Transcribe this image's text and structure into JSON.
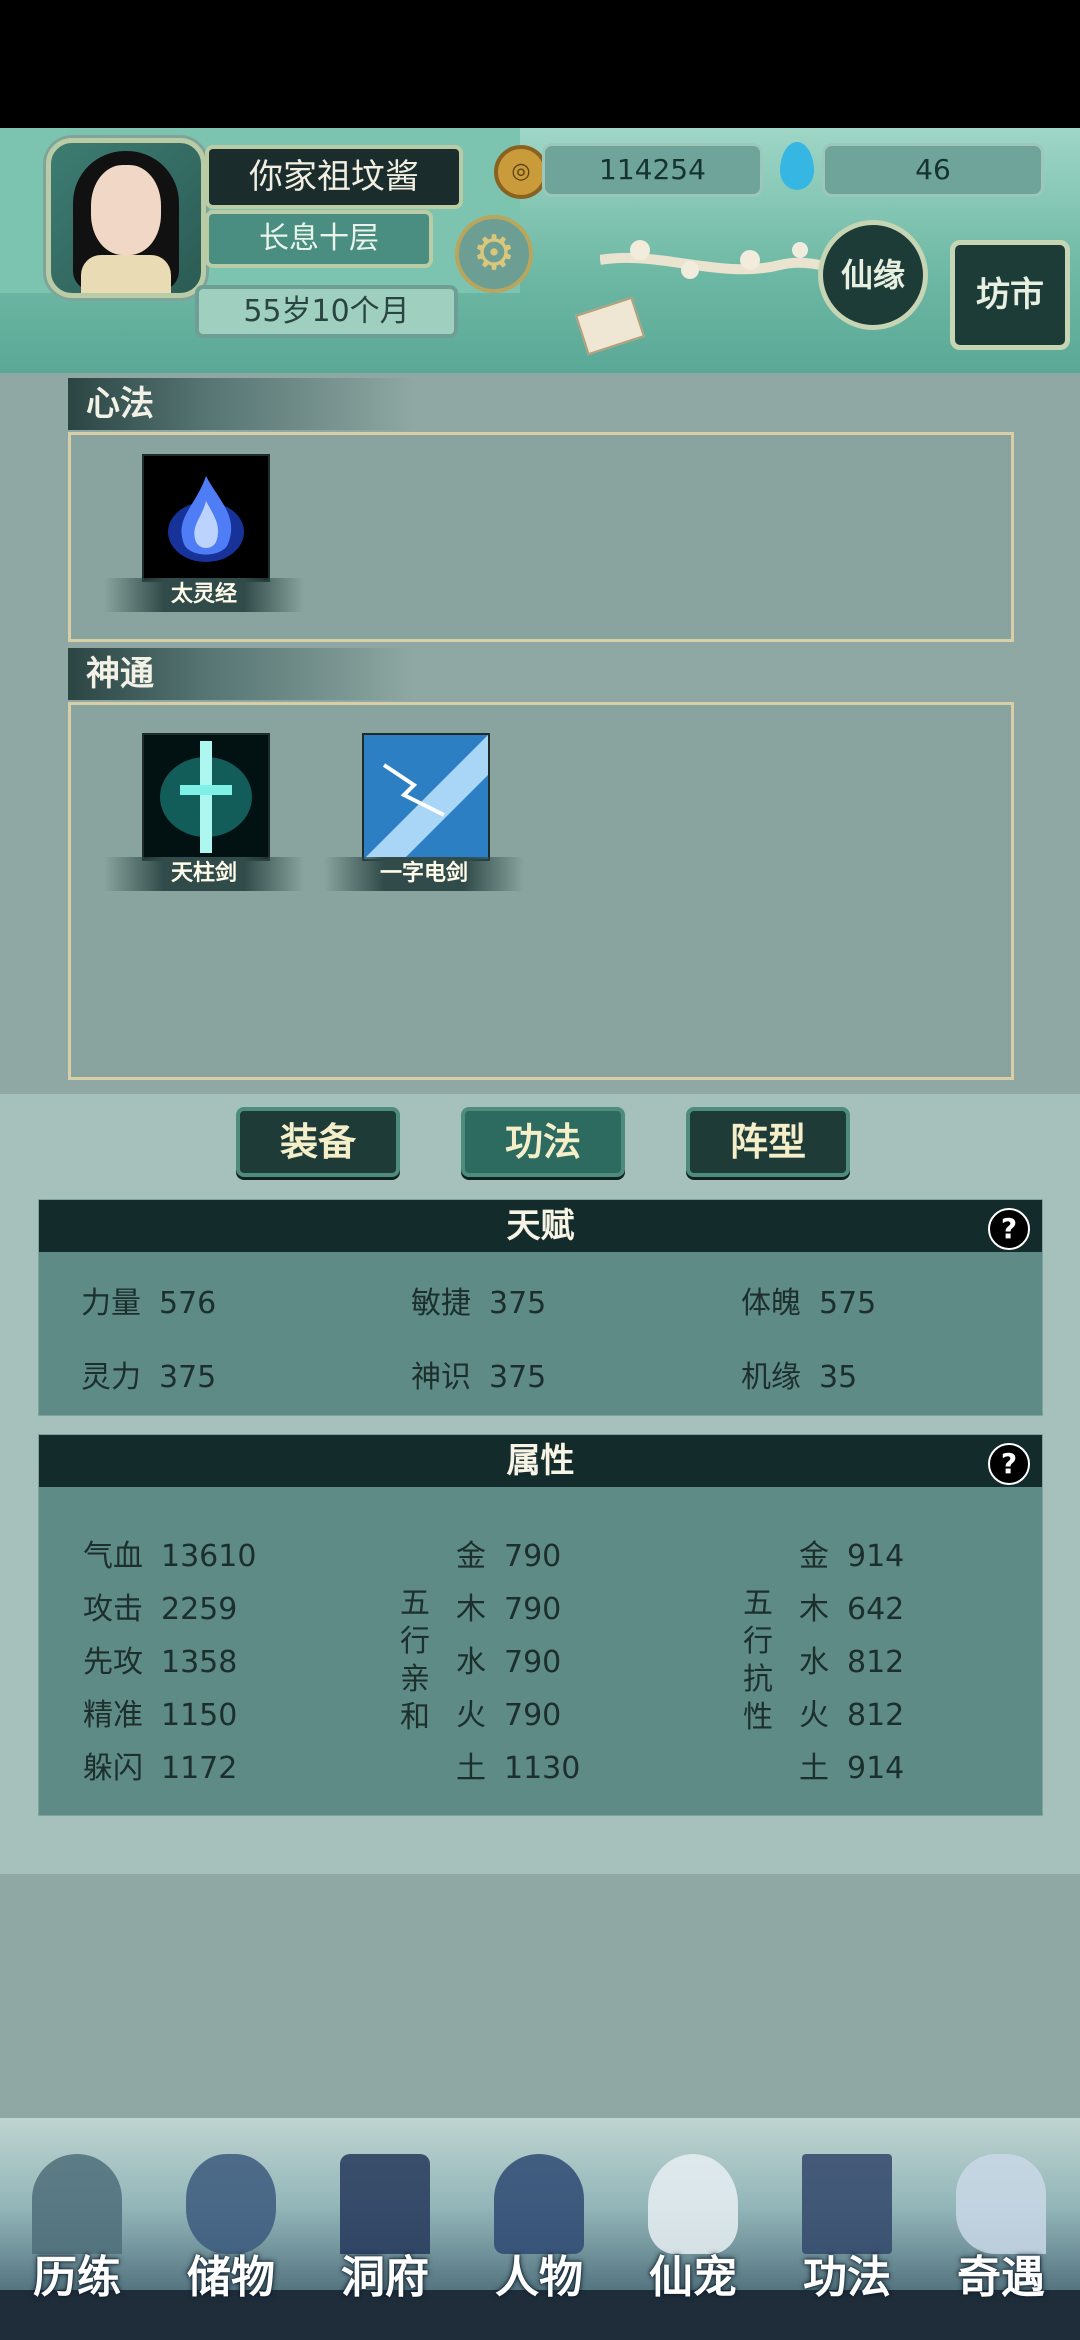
{
  "player": {
    "name": "你家祖坟酱",
    "realm": "长息十层",
    "age": "55岁10个月",
    "coins": "114254",
    "gems": "46"
  },
  "header_buttons": {
    "xianyuan": "仙缘",
    "fangshi": "坊市"
  },
  "sections": {
    "xinfa": {
      "label": "心法",
      "skills": [
        {
          "name": "太灵经"
        }
      ]
    },
    "shentong": {
      "label": "神通",
      "skills": [
        {
          "name": "天柱剑"
        },
        {
          "name": "一字电剑"
        }
      ]
    }
  },
  "tabs": [
    {
      "label": "装备"
    },
    {
      "label": "功法"
    },
    {
      "label": "阵型"
    }
  ],
  "active_tab": "功法",
  "talent": {
    "title": "天赋",
    "help": "?",
    "stats": [
      {
        "label": "力量",
        "value": "576"
      },
      {
        "label": "敏捷",
        "value": "375"
      },
      {
        "label": "体魄",
        "value": "575"
      },
      {
        "label": "灵力",
        "value": "375"
      },
      {
        "label": "神识",
        "value": "375"
      },
      {
        "label": "机缘",
        "value": "35"
      }
    ]
  },
  "attributes": {
    "title": "属性",
    "help": "?",
    "basic": [
      {
        "label": "气血",
        "value": "13610"
      },
      {
        "label": "攻击",
        "value": "2259"
      },
      {
        "label": "先攻",
        "value": "1358"
      },
      {
        "label": "精准",
        "value": "1150"
      },
      {
        "label": "躲闪",
        "value": "1172"
      }
    ],
    "affinity_label": [
      "五",
      "行",
      "亲",
      "和"
    ],
    "affinity": [
      {
        "label": "金",
        "value": "790"
      },
      {
        "label": "木",
        "value": "790"
      },
      {
        "label": "水",
        "value": "790"
      },
      {
        "label": "火",
        "value": "790"
      },
      {
        "label": "土",
        "value": "1130"
      }
    ],
    "resistance_label": [
      "五",
      "行",
      "抗",
      "性"
    ],
    "resistance": [
      {
        "label": "金",
        "value": "914"
      },
      {
        "label": "木",
        "value": "642"
      },
      {
        "label": "水",
        "value": "812"
      },
      {
        "label": "火",
        "value": "812"
      },
      {
        "label": "土",
        "value": "914"
      }
    ]
  },
  "nav": [
    {
      "label": "历练",
      "icon": "mountain-icon"
    },
    {
      "label": "储物",
      "icon": "bag-icon"
    },
    {
      "label": "洞府",
      "icon": "pagoda-icon"
    },
    {
      "label": "人物",
      "icon": "person-icon"
    },
    {
      "label": "仙宠",
      "icon": "spirit-pet-icon"
    },
    {
      "label": "功法",
      "icon": "scroll-book-icon"
    },
    {
      "label": "奇遇",
      "icon": "crane-icon"
    }
  ],
  "colors": {
    "header_bg": "#6db8a4",
    "panel_header": "#132b2b",
    "panel_body": "#5f8b86",
    "tab_text": "#f4eec9"
  }
}
